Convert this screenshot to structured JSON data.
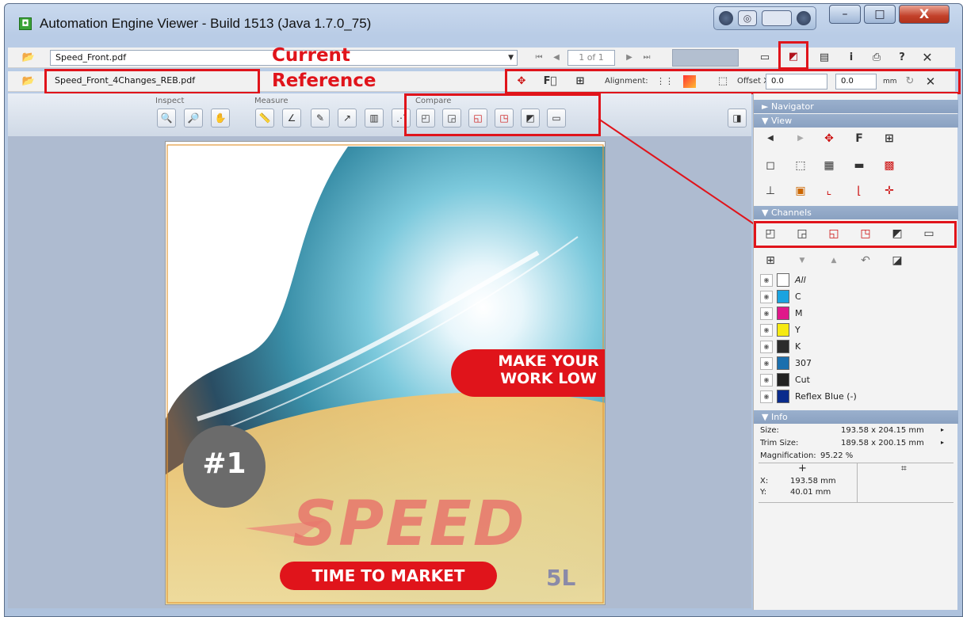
{
  "window": {
    "title": "Automation Engine Viewer - Build 1513 (Java 1.7.0_75)",
    "minimize": "–",
    "maximize": "□",
    "close": "X"
  },
  "current": {
    "file": "Speed_Front.pdf",
    "label": "Current",
    "page_indicator": "1 of 1"
  },
  "reference": {
    "file": "Speed_Front_4Changes_REB.pdf",
    "label": "Reference",
    "alignment_label": "Alignment:",
    "offset_label": "Offset X,Y:",
    "offset_x": "0.0",
    "offset_y": "0.0",
    "unit": "mm"
  },
  "toolbar": {
    "inspect_label": "Inspect",
    "measure_label": "Measure",
    "compare_label": "Compare"
  },
  "panel": {
    "navigator": "Navigator",
    "view": "View",
    "channels": "Channels",
    "info": "Info",
    "channel_list": [
      {
        "name": "All",
        "color": "#ffffff"
      },
      {
        "name": "C",
        "color": "#1aa3e0"
      },
      {
        "name": "M",
        "color": "#e0188a"
      },
      {
        "name": "Y",
        "color": "#f6ea12"
      },
      {
        "name": "K",
        "color": "#2b2b2b"
      },
      {
        "name": "307",
        "color": "#1b6fae"
      },
      {
        "name": "Cut",
        "color": "#222222"
      },
      {
        "name": "Reflex Blue (-)",
        "color": "#0a2b8c"
      }
    ],
    "info_rows": {
      "size_k": "Size:",
      "size_v": "193.58 x 204.15 mm",
      "trim_k": "Trim Size:",
      "trim_v": "189.58 x 200.15 mm",
      "mag_k": "Magnification:",
      "mag_v": "95.22 %",
      "x_k": "X:",
      "x_v": "193.58 mm",
      "y_k": "Y:",
      "y_v": "40.01 mm"
    }
  },
  "artwork": {
    "banner_line1": "MAKE YOUR",
    "banner_line2": "WORK  LOW",
    "badge": "#1",
    "headline": "SPEED",
    "tagline": "TIME TO MARKET",
    "logo": "5L"
  },
  "colors": {
    "highlight": "#e0141b",
    "panel_header": "#8aa1c1"
  }
}
